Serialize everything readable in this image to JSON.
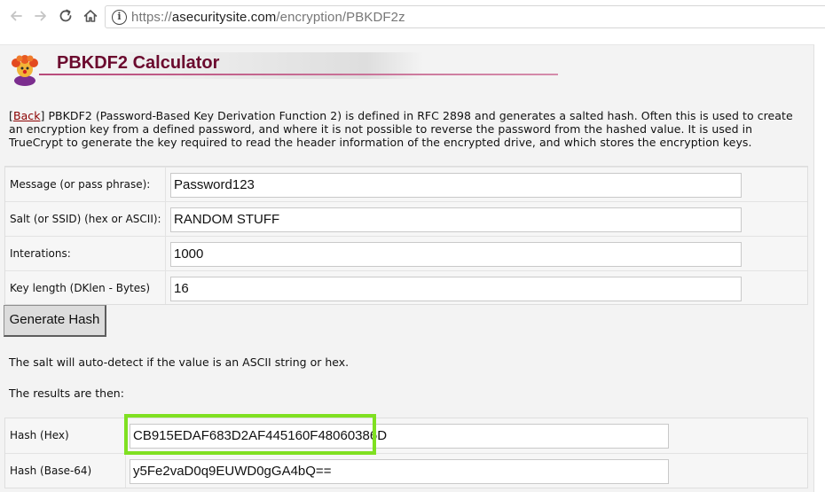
{
  "browser": {
    "url_scheme": "https://",
    "url_host": "asecuritysite.com",
    "url_path": "/encryption/PBKDF2z",
    "icons": [
      "back-arrow-icon",
      "forward-arrow-icon",
      "reload-icon",
      "home-icon",
      "info-icon"
    ]
  },
  "page": {
    "title": "PBKDF2 Calculator",
    "intro_bracket_open": "[",
    "back_link": "Back",
    "intro_bracket_close": "]",
    "intro_text": " PBKDF2 (Password-Based Key Derivation Function 2) is defined in RFC 2898 and generates a salted hash. Often this is used to create an encryption key from a defined password, and where it is not possible to reverse the password from the hashed value. It is used in TrueCrypt to generate the key required to read the header information of the encrypted drive, and which stores the encryption keys."
  },
  "form": {
    "message_label": "Message (or pass phrase):",
    "message_value": "Password123",
    "salt_label": "Salt (or SSID) (hex or ASCII):",
    "salt_value": "RANDOM STUFF",
    "iterations_label": "Interations:",
    "iterations_value": "1000",
    "keylen_label": "Key length (DKlen - Bytes)",
    "keylen_value": "16",
    "generate_button": "Generate Hash"
  },
  "notes": {
    "salt_note": "The salt will auto-detect if the value is an ASCII string or hex.",
    "results_note": "The results are then:"
  },
  "results": {
    "hex_label": "Hash (Hex)",
    "hex_value": "CB915EDAF683D2AF445160F48060386D",
    "b64_label": "Hash (Base-64)",
    "b64_value": "y5Fe2vaD0q9EUWD0gGA4bQ=="
  },
  "colors": {
    "title": "#6b0a2e",
    "link": "#8b0000",
    "highlight": "#7fe021"
  }
}
